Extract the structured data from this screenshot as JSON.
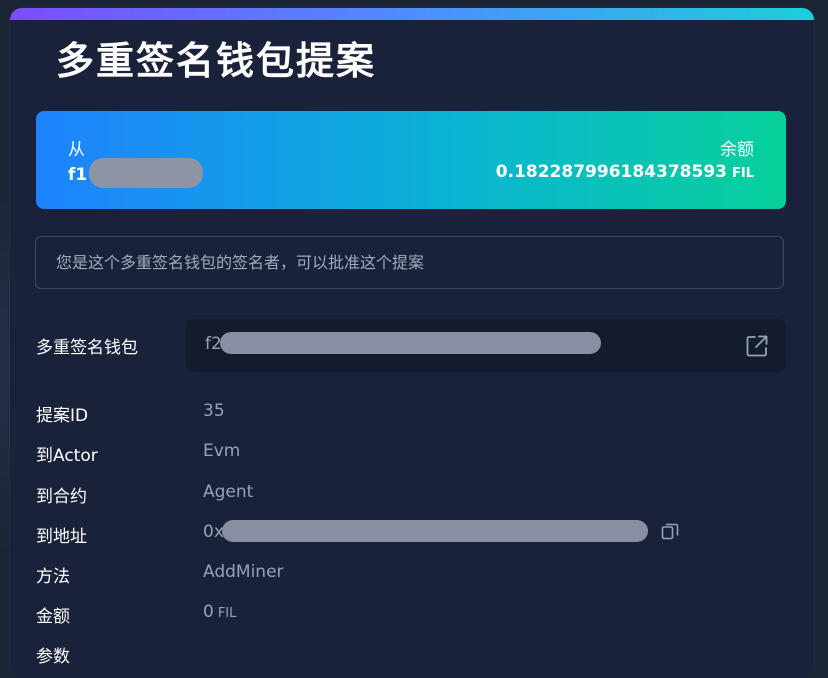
{
  "page": {
    "title": "多重签名钱包提案"
  },
  "from_card": {
    "from_label": "从",
    "from_address_prefix": "f1",
    "balance_label": "余额",
    "balance_value": "0.182287996184378593",
    "balance_unit": "FIL"
  },
  "notice": {
    "text": "您是这个多重签名钱包的签名者，可以批准这个提案"
  },
  "multisig_wallet": {
    "label": "多重签名钱包",
    "address_prefix": "f2"
  },
  "details": {
    "proposal_id_label": "提案ID",
    "proposal_id_value": "35",
    "to_actor_label": "到Actor",
    "to_actor_value": "Evm",
    "to_contract_label": "到合约",
    "to_contract_value": "Agent",
    "to_address_label": "到地址",
    "to_address_prefix": "0x",
    "method_label": "方法",
    "method_value": "AddMiner",
    "amount_label": "金额",
    "amount_value": "0",
    "amount_unit": "FIL",
    "params_label": "参数"
  },
  "icons": {
    "external_link": "external-link-icon",
    "copy": "copy-icon"
  },
  "colors": {
    "accent_gradient_start": "#1e82ff",
    "accent_gradient_end": "#08d19a",
    "card_background": "#19223a",
    "muted_text": "#9aa1b6"
  }
}
